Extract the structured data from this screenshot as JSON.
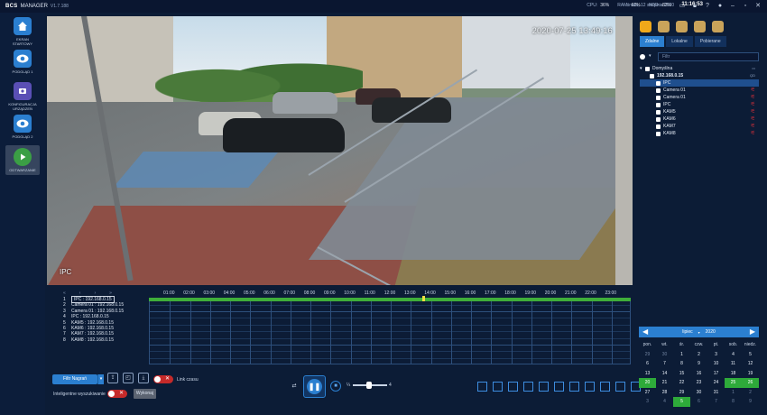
{
  "app": {
    "brand": "BCS",
    "name": "MANAGER",
    "version": "V1.7.188"
  },
  "system": {
    "cpu_label": "CPU:",
    "cpu": "36%",
    "ram_label": "RAM:",
    "ram": "62%",
    "hdd_label": "HDD:",
    "hdd": "83%",
    "date": "środa, 12 sierpnia 2020",
    "time": "11:16:53"
  },
  "top_icons": [
    "monitor-icon",
    "lock-icon",
    "help-icon",
    "user-icon",
    "minimize-icon",
    "maximize-icon",
    "close-icon"
  ],
  "sidebar": {
    "items": [
      {
        "label": "EKRAN STARTOWY",
        "icon": "home-icon"
      },
      {
        "label": "PODGLĄD 1",
        "icon": "eye-icon"
      },
      {
        "label": "KONFIGURACJA URZĄDZEŃ",
        "icon": "config-icon"
      },
      {
        "label": "PODGLĄD 2",
        "icon": "eye-icon"
      },
      {
        "label": "ODTWARZANIE",
        "icon": "play-icon"
      }
    ]
  },
  "video": {
    "timestamp": "2020-07-25 13:49:16",
    "camera_label": "IPC"
  },
  "timeline": {
    "cameras": [
      {
        "num": "1",
        "name": "IPC : 192.168.0.15"
      },
      {
        "num": "2",
        "name": "Camera 01 : 192.168.0.15"
      },
      {
        "num": "3",
        "name": "Camera 01 : 192.168.0.15"
      },
      {
        "num": "4",
        "name": "IPC : 192.168.0.15"
      },
      {
        "num": "5",
        "name": "KAM5 : 192.168.0.15"
      },
      {
        "num": "6",
        "name": "KAM6 : 192.168.0.15"
      },
      {
        "num": "7",
        "name": "KAM7 : 192.168.0.15"
      },
      {
        "num": "8",
        "name": "KAM8 : 192.168.0.15"
      }
    ],
    "hours": [
      "01:00",
      "02:00",
      "03:00",
      "04:00",
      "05:00",
      "06:00",
      "07:00",
      "08:00",
      "09:00",
      "10:00",
      "11:00",
      "12:00",
      "13:00",
      "14:00",
      "15:00",
      "16:00",
      "17:00",
      "18:00",
      "19:00",
      "20:00",
      "21:00",
      "22:00",
      "23:00"
    ]
  },
  "controls": {
    "filter_label": "Filtr Nagrań",
    "time_link_label": "Link czasu",
    "smart_search_label": "Inteligentne wyszukiwanie",
    "execute_label": "Wykonaj",
    "speed_label": "¼",
    "speed_max_label": "4"
  },
  "right_panel": {
    "tabs": [
      "Zdalne",
      "Lokalne",
      "Pobierane"
    ],
    "filter_placeholder": "Filtr",
    "tree": [
      {
        "label": "Domyślna",
        "level": 0
      },
      {
        "label": "192.168.0.15",
        "level": 1,
        "tag": "QD"
      },
      {
        "label": "IPC",
        "level": 2,
        "selected": true
      },
      {
        "label": "Camera 01",
        "level": 2
      },
      {
        "label": "Camera 01",
        "level": 2
      },
      {
        "label": "IPC",
        "level": 2
      },
      {
        "label": "KAM5",
        "level": 2
      },
      {
        "label": "KAM6",
        "level": 2
      },
      {
        "label": "KAM7",
        "level": 2
      },
      {
        "label": "KAM8",
        "level": 2
      }
    ],
    "calendar": {
      "month": "lipiec",
      "year": "2020",
      "weekdays": [
        "pon.",
        "wt.",
        "śr.",
        "czw.",
        "pt.",
        "sob.",
        "niedz."
      ],
      "days": [
        [
          "29",
          "30",
          "1",
          "2",
          "3",
          "4",
          "5"
        ],
        [
          "6",
          "7",
          "8",
          "9",
          "10",
          "11",
          "12"
        ],
        [
          "13",
          "14",
          "15",
          "16",
          "17",
          "18",
          "19"
        ],
        [
          "20",
          "21",
          "22",
          "23",
          "24",
          "25",
          "26"
        ],
        [
          "27",
          "28",
          "29",
          "30",
          "31",
          "1",
          "2"
        ],
        [
          "3",
          "4",
          "5",
          "6",
          "7",
          "8",
          "9"
        ]
      ]
    }
  },
  "colors": {
    "accent": "#2b7fd0",
    "record_green": "#3fae3a",
    "alert_red": "#c52a2a"
  }
}
